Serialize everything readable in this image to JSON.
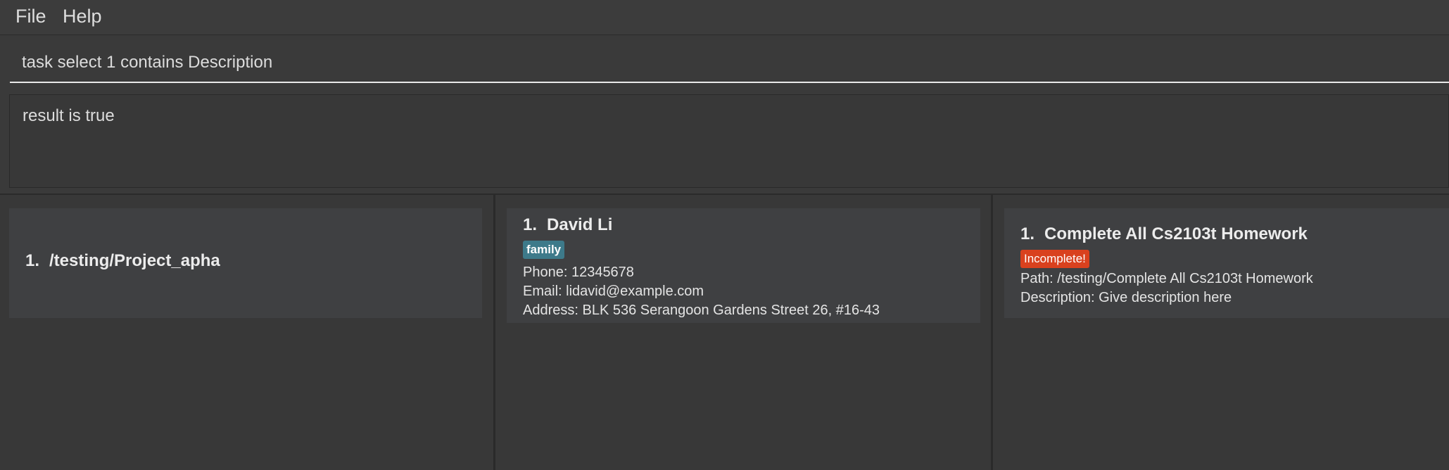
{
  "menu": {
    "file": "File",
    "help": "Help"
  },
  "command": {
    "value": "task select 1 contains Description"
  },
  "result": {
    "text": "result is true"
  },
  "projects": {
    "items": [
      {
        "index": "1.",
        "path": "/testing/Project_apha"
      }
    ]
  },
  "persons": {
    "items": [
      {
        "index": "1.",
        "name": "David Li",
        "tag": "family",
        "tag_color": "#3d7a8a",
        "phone": "Phone: 12345678",
        "email": "Email: lidavid@example.com",
        "address": "Address: BLK 536 Serangoon Gardens Street 26, #16-43"
      }
    ]
  },
  "tasks": {
    "items": [
      {
        "index": "1.",
        "title": "Complete All Cs2103t Homework",
        "status": "Incomplete!",
        "status_color": "#d9411e",
        "path": "Path: /testing/Complete All Cs2103t Homework",
        "description": "Description: Give description here"
      }
    ]
  }
}
